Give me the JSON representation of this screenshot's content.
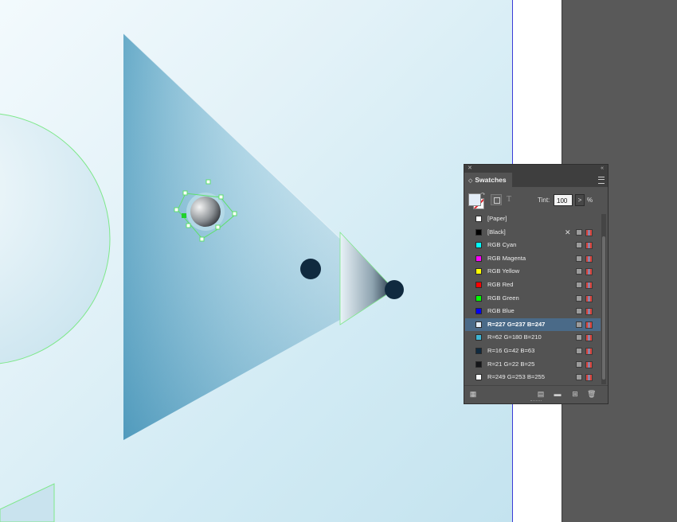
{
  "app": {
    "window": "InDesign document canvas"
  },
  "panel": {
    "close_glyph": "✕",
    "collapse_glyph": "«",
    "tab_marker": "◇",
    "tab_label": "Swatches",
    "tint_label": "Tint:",
    "tint_value": "100",
    "tint_arrow": ">",
    "tint_unit": "%",
    "t_button": "T"
  },
  "swatches": [
    {
      "name": "[Paper]",
      "color": "#ffffff",
      "selected": false,
      "no_edit": false
    },
    {
      "name": "[Black]",
      "color": "#000000",
      "selected": false,
      "no_edit": true
    },
    {
      "name": "RGB Cyan",
      "color": "#00ffff",
      "selected": false,
      "no_edit": false
    },
    {
      "name": "RGB Magenta",
      "color": "#ff00ff",
      "selected": false,
      "no_edit": false
    },
    {
      "name": "RGB Yellow",
      "color": "#ffff00",
      "selected": false,
      "no_edit": false
    },
    {
      "name": "RGB Red",
      "color": "#ff0000",
      "selected": false,
      "no_edit": false
    },
    {
      "name": "RGB Green",
      "color": "#00ff00",
      "selected": false,
      "no_edit": false
    },
    {
      "name": "RGB Blue",
      "color": "#0000ff",
      "selected": false,
      "no_edit": false
    },
    {
      "name": "R=227 G=237 B=247",
      "color": "#e3edf7",
      "selected": true,
      "no_edit": false
    },
    {
      "name": "R=62 G=180 B=210",
      "color": "#3eb4d2",
      "selected": false,
      "no_edit": false
    },
    {
      "name": "R=16 G=42 B=63",
      "color": "#102a3f",
      "selected": false,
      "no_edit": false
    },
    {
      "name": "R=21 G=22 B=25",
      "color": "#151619",
      "selected": false,
      "no_edit": false
    },
    {
      "name": "R=249 G=253 B=255",
      "color": "#f9fdff",
      "selected": false,
      "no_edit": false
    }
  ],
  "icons": {
    "bottom": [
      "swatch-views-icon",
      "new-color-group-icon",
      "folder-icon",
      "new-swatch-icon",
      "delete-swatch-icon"
    ]
  },
  "colors": {
    "panel_bg": "#535353",
    "selection": "#4a6a88",
    "canvas_guide": "#7ee88a",
    "pasteboard": "#595959"
  }
}
